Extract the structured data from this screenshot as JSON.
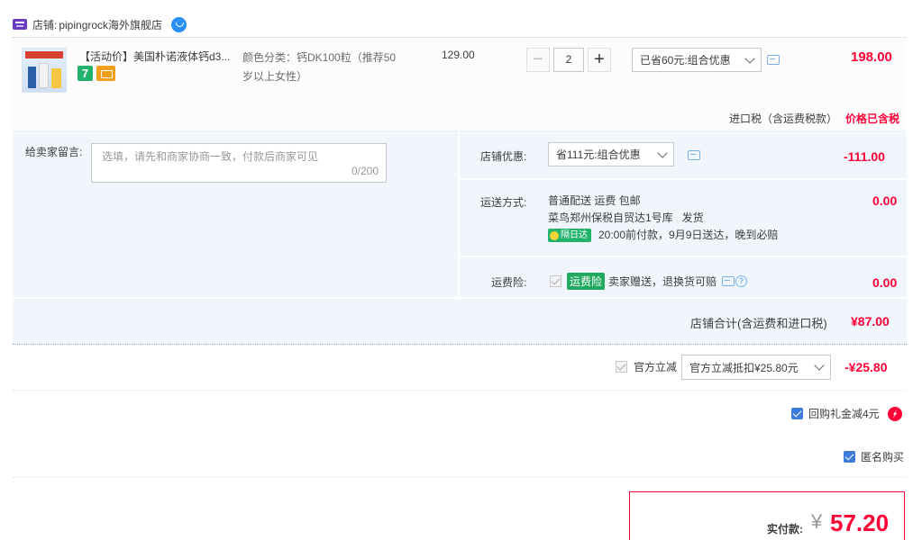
{
  "shop": {
    "label": "店铺:",
    "name": "pipingrock海外旗舰店"
  },
  "item": {
    "title": "【活动价】美国朴诺液体钙d3...",
    "badge_7": "7",
    "sku_label": "颜色分类:",
    "sku_value": "钙DK100粒（推荐50岁以上女性）",
    "sku_line1": "颜色分类：钙DK100粒（推荐50",
    "sku_line2": "岁以上女性）",
    "unit_price": "129.00",
    "quantity": "2",
    "discount_select": "已省60元:组合优惠",
    "total": "198.00",
    "tax_label": "进口税（含运费税款）",
    "tax_value": "价格已含税"
  },
  "detail": {
    "message_label": "给卖家留言:",
    "message_placeholder": "选填，请先和商家协商一致，付款后商家可见",
    "message_count": "0/200",
    "shop_discount_label": "店铺优惠:",
    "shop_discount_select": "省111元:组合优惠",
    "shop_discount_amount": "-111.00",
    "shipping_label": "运送方式:",
    "shipping_line1": "普通配送 运费 包邮",
    "shipping_line2": "菜鸟郑州保税自贸达1号库   发货",
    "shipping_badge": "隔日达",
    "shipping_line3": "20:00前付款，9月9日送达，晚到必赔",
    "shipping_amount": "0.00",
    "insurance_label": "运费险:",
    "insurance_badge": "运费险",
    "insurance_text": "卖家赠送，退换货可赔",
    "insurance_amount": "0.00",
    "shop_total_label": "店铺合计(含运费和进口税)",
    "shop_total_value": "¥87.00"
  },
  "official": {
    "label": "官方立减",
    "select": "官方立减抵扣¥25.80元",
    "amount": "-¥25.80"
  },
  "gift": {
    "label": "回购礼金减4元"
  },
  "anonymous": {
    "label": "匿名购买"
  },
  "payment": {
    "label": "实付款:",
    "currency": "¥",
    "value": "57.20"
  },
  "colors": {
    "accent_red": "#ff0036",
    "brand_blue": "#3d7bd9",
    "panel_bg": "#f1f6fc"
  }
}
